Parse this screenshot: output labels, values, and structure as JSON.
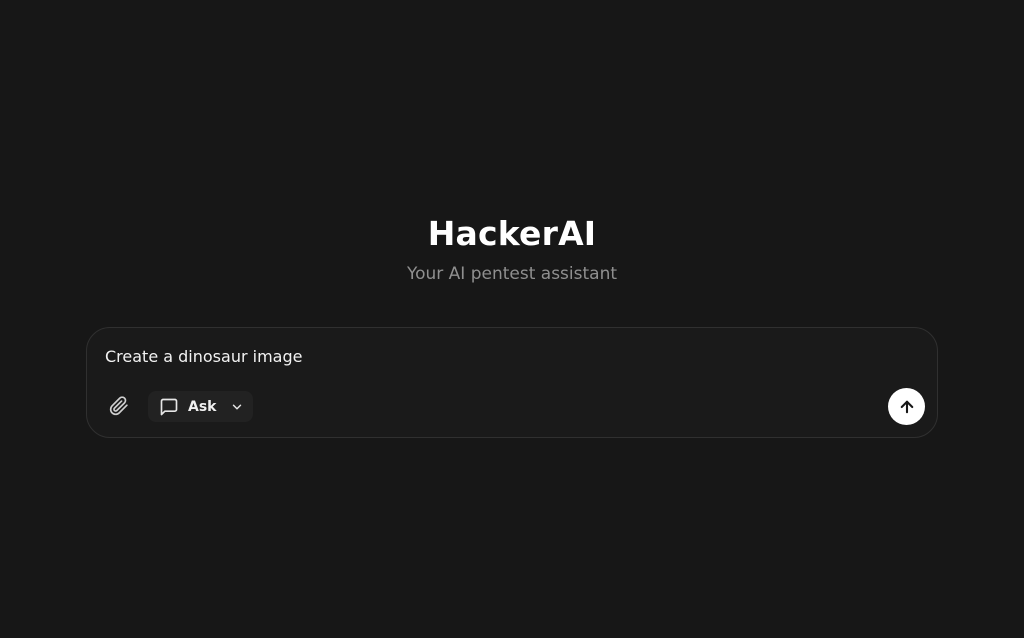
{
  "hero": {
    "title": "HackerAI",
    "subtitle": "Your AI pentest assistant"
  },
  "composer": {
    "prompt_value": "Create a dinosaur image",
    "attach_icon": "paperclip-icon",
    "mode": {
      "label": "Ask",
      "icon": "message-square-icon",
      "dropdown_icon": "chevron-down-icon"
    },
    "send_icon": "arrow-up-icon"
  },
  "colors": {
    "background": "#171717",
    "composer_background": "#1a1a1a",
    "composer_border": "#303030",
    "subtitle": "#8f8f8f",
    "send_button": "#ffffff"
  }
}
